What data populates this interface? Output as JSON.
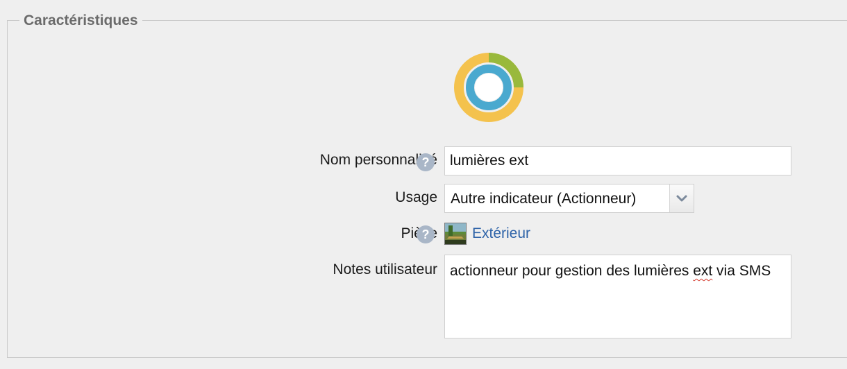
{
  "section": {
    "legend": "Caractéristiques"
  },
  "device_icon": "ring-status-icon",
  "fields": {
    "name": {
      "label": "Nom personnalisé",
      "value": "lumières ext"
    },
    "usage": {
      "label": "Usage",
      "selected": "Autre indicateur (Actionneur)"
    },
    "room": {
      "label": "Pièce",
      "value": "Extérieur",
      "icon": "garden-room-icon"
    },
    "notes": {
      "label": "Notes utilisateur",
      "value_before": "actionneur pour gestion des lumières ",
      "value_flagged": "ext",
      "value_after": " via SMS"
    }
  },
  "colors": {
    "ring_yellow": "#f4c24d",
    "ring_green": "#99b93c",
    "ring_blue": "#4aa9cf",
    "link": "#2e63a8"
  }
}
